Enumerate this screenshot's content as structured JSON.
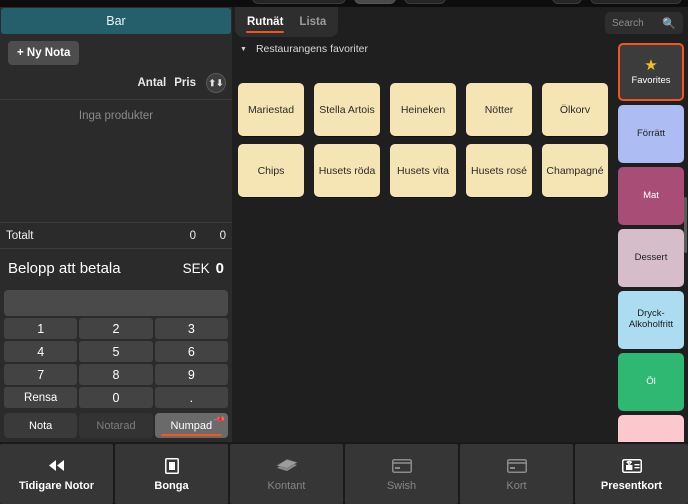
{
  "left_panel": {
    "header_title": "Bar",
    "header_color": "#245f6b",
    "new_note_label": "+ Ny Nota",
    "col_qty": "Antal",
    "col_price": "Pris",
    "sort_icon": "sort-updown-icon",
    "empty_message": "Inga produkter",
    "totals": {
      "label": "Totalt",
      "qty": "0",
      "amount": "0"
    },
    "payable": {
      "label": "Belopp att betala",
      "currency": "SEK",
      "amount": "0"
    },
    "numpad": {
      "display_value": "",
      "keys": [
        "1",
        "2",
        "3",
        "4",
        "5",
        "6",
        "7",
        "8",
        "9",
        "Rensa",
        "0",
        "."
      ]
    },
    "mode_tabs": [
      {
        "label": "Nota",
        "state": "normal"
      },
      {
        "label": "Notarad",
        "state": "dim"
      },
      {
        "label": "Numpad",
        "state": "active"
      }
    ],
    "pin_icon": "pin-icon"
  },
  "main": {
    "view_tabs": [
      {
        "label": "Rutnät",
        "active": true
      },
      {
        "label": "Lista",
        "active": false
      }
    ],
    "search": {
      "placeholder": "Search",
      "value": "",
      "icon": "search-icon"
    },
    "section": {
      "caret_icon": "caret-down-icon",
      "title": "Restaurangens favoriter"
    },
    "products": [
      "Mariestad",
      "Stella Artois",
      "Heineken",
      "Nötter",
      "Ölkorv",
      "Chips",
      "Husets röda",
      "Husets vita",
      "Husets rosé",
      "Champagné"
    ],
    "product_tile_color": "#f6e5b4",
    "categories": [
      {
        "label": "Favorites",
        "color": "#3c3c3c",
        "text_color": "#ffffff",
        "selected": true,
        "icon": "star-icon"
      },
      {
        "label": "Förrätt",
        "color": "#adbdf4",
        "text_color": "#1e1e1e",
        "selected": false
      },
      {
        "label": "Mat",
        "color": "#a84d75",
        "text_color": "#ffffff",
        "selected": false
      },
      {
        "label": "Dessert",
        "color": "#d6bdc9",
        "text_color": "#1e1e1e",
        "selected": false
      },
      {
        "label": "Dryck-Alkoholfritt",
        "color": "#abdcf0",
        "text_color": "#1e1e1e",
        "selected": false
      },
      {
        "label": "Öl",
        "color": "#2eb872",
        "text_color": "#ffffff",
        "selected": false
      },
      {
        "label": "",
        "color": "#fac8cd",
        "text_color": "#1e1e1e",
        "selected": false
      }
    ]
  },
  "bottom_bar": [
    {
      "label": "Tidigare Notor",
      "icon": "rewind-icon",
      "enabled": true
    },
    {
      "label": "Bonga",
      "icon": "receipt-icon",
      "enabled": true
    },
    {
      "label": "Kontant",
      "icon": "cash-icon",
      "enabled": false
    },
    {
      "label": "Swish",
      "icon": "card-icon",
      "enabled": false
    },
    {
      "label": "Kort",
      "icon": "card-icon",
      "enabled": false
    },
    {
      "label": "Presentkort",
      "icon": "giftcard-icon",
      "enabled": true
    }
  ],
  "accent_color": "#f0561d"
}
